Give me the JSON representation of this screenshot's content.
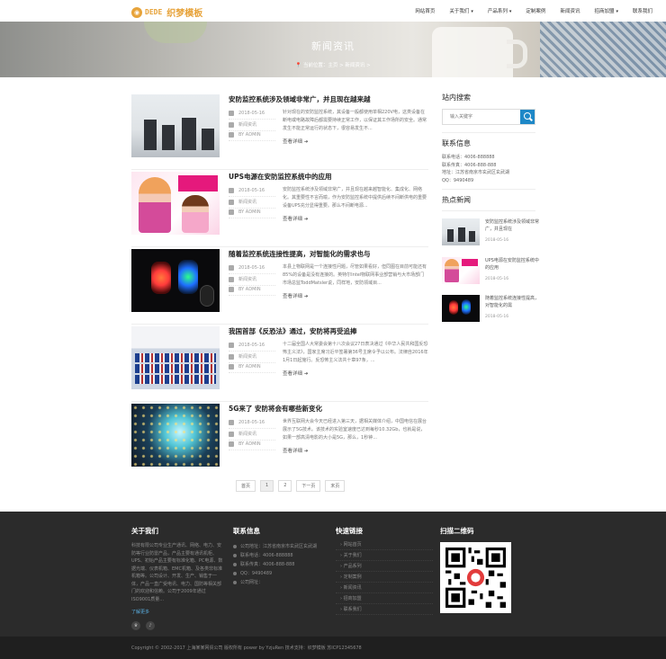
{
  "header": {
    "logo_en": "DEDE",
    "logo_cn": "织梦模板",
    "nav": [
      {
        "label": "网站首页",
        "dropdown": false
      },
      {
        "label": "关于我们",
        "dropdown": true
      },
      {
        "label": "产品系列",
        "dropdown": true
      },
      {
        "label": "定制案例",
        "dropdown": false
      },
      {
        "label": "新闻资讯",
        "dropdown": false
      },
      {
        "label": "招商加盟",
        "dropdown": true
      },
      {
        "label": "联系我们",
        "dropdown": false
      }
    ],
    "caret": "▾"
  },
  "banner": {
    "title": "新闻资讯",
    "breadcrumb": "📍 当前位置：主页 > 新闻资讯 >"
  },
  "news": [
    {
      "title": "安防监控系统涉及领域非常广，并且现在越来越",
      "date": "2018-05-16",
      "category": "新闻资讯",
      "author": "BY ADMIN",
      "summary": "针对现在的安防监控系统，其设备一般都使用单相220V电，这类设备在断电或电路故障后都需要持续正常工作，以保证其工作场所的安全。通常发生不能正常运行的状态下，很容易发生不...",
      "more": "查看详细 ➜"
    },
    {
      "title": "UPS电源在安防监控系统中的应用",
      "date": "2018-05-16",
      "category": "新闻资讯",
      "author": "BY ADMIN",
      "summary": "安防监控系统涉及领域非常广，并且现在越来越智能化、集成化、网络化。其重要性不言而喻，作为安防监控系统中提供后续不间断供电的重要设备UPS充分显得重要。那么不间断电源...",
      "more": "查看详细 ➜"
    },
    {
      "title": "随着监控系统连接性提高，对智能化的需求也与",
      "date": "2018-05-16",
      "category": "新闻资讯",
      "author": "BY ADMIN",
      "summary": "本县上物联网是一个连接性问题，尽管如果看好，但同图在目前可能还有85%的设备是没有连接的。英特尔Intel物联网事业部营销与大市场部门市场总监ToddMatsler说，同样地，安防领域目...",
      "more": "查看详细 ➜"
    },
    {
      "title": "我国首部《反恐法》通过，安防将再受追捧",
      "date": "2018-05-16",
      "category": "新闻资讯",
      "author": "BY ADMIN",
      "summary": "十二届全国人大常委会第十八次会议27日表决通过《中华人民共和国反恐怖主义法》，国家主席习近平签署第36号主席令予以公布。法律自2016年1月1日起施行。反恐怖主义法共十章97条，...",
      "more": "查看详细 ➜"
    },
    {
      "title": "5G来了 安防将会有哪些新变化",
      "date": "2018-05-16",
      "category": "新闻资讯",
      "author": "BY ADMIN",
      "summary": "世界互联网大会今天已经进入第三天，据相关媒体介绍，中国电信在展台展示了5G技术。该技术的实验室速度已达到每秒10.32Gb，也就是说，如果一部高清电影的大小是5G，那么，1秒钟...",
      "more": "查看详细 ➜"
    }
  ],
  "pager": [
    "首页",
    "1",
    "2",
    "下一页",
    "末页"
  ],
  "sidebar": {
    "search_title": "站内搜索",
    "search_placeholder": "输入关键字",
    "contact_title": "联系信息",
    "contact_lines": [
      "联系电话：4006-888888",
      "联系传真：4006-888-888",
      "地址：江苏省南京市玄武区玄武湖",
      "QQ：9490489"
    ],
    "hot_title": "热点新闻",
    "hot": [
      {
        "title": "安防监控系统涉及领域非常广，并且现在",
        "date": "2018-05-16"
      },
      {
        "title": "UPS电源在安防监控系统中的应用",
        "date": "2018-05-16"
      },
      {
        "title": "随着监控系统连接性提高，对智能化的需",
        "date": "2018-05-16"
      }
    ]
  },
  "footer": {
    "about_title": "关于我们",
    "about_text": "科技有限公司专业生产通讯、网络、电力、安防等行业防雷产品，产品主要有通讯机柜、UPS、初始产品主要有标准化箱、PC电源、数据光端、仪表机箱、EMC机箱、及各类非标准机箱等。公司设计、开发、生产、销售于一体，产品一直广受电讯、电力、国防等相关部门的欢迎和信赖。公司于2009年通过ISO9001质量...",
    "about_more": "了解更多",
    "contact_title": "联系信息",
    "contact": [
      "公司地址：江苏省南京市玄武区玄武湖",
      "联系电话：4006-888888",
      "联系传真：4006-888-888",
      "QQ：9490489",
      "公司网址："
    ],
    "links_title": "快速链接",
    "links": [
      "网站首页",
      "关于我们",
      "产品系列",
      "定制案例",
      "新闻资讯",
      "招商加盟",
      "联系我们"
    ],
    "qr_title": "扫描二维码",
    "copyright": "Copyright © 2002-2017 上海某某网贸公司 版权所有 power by YzjuRen     技术支持：织梦模板     苏ICP12345678"
  }
}
